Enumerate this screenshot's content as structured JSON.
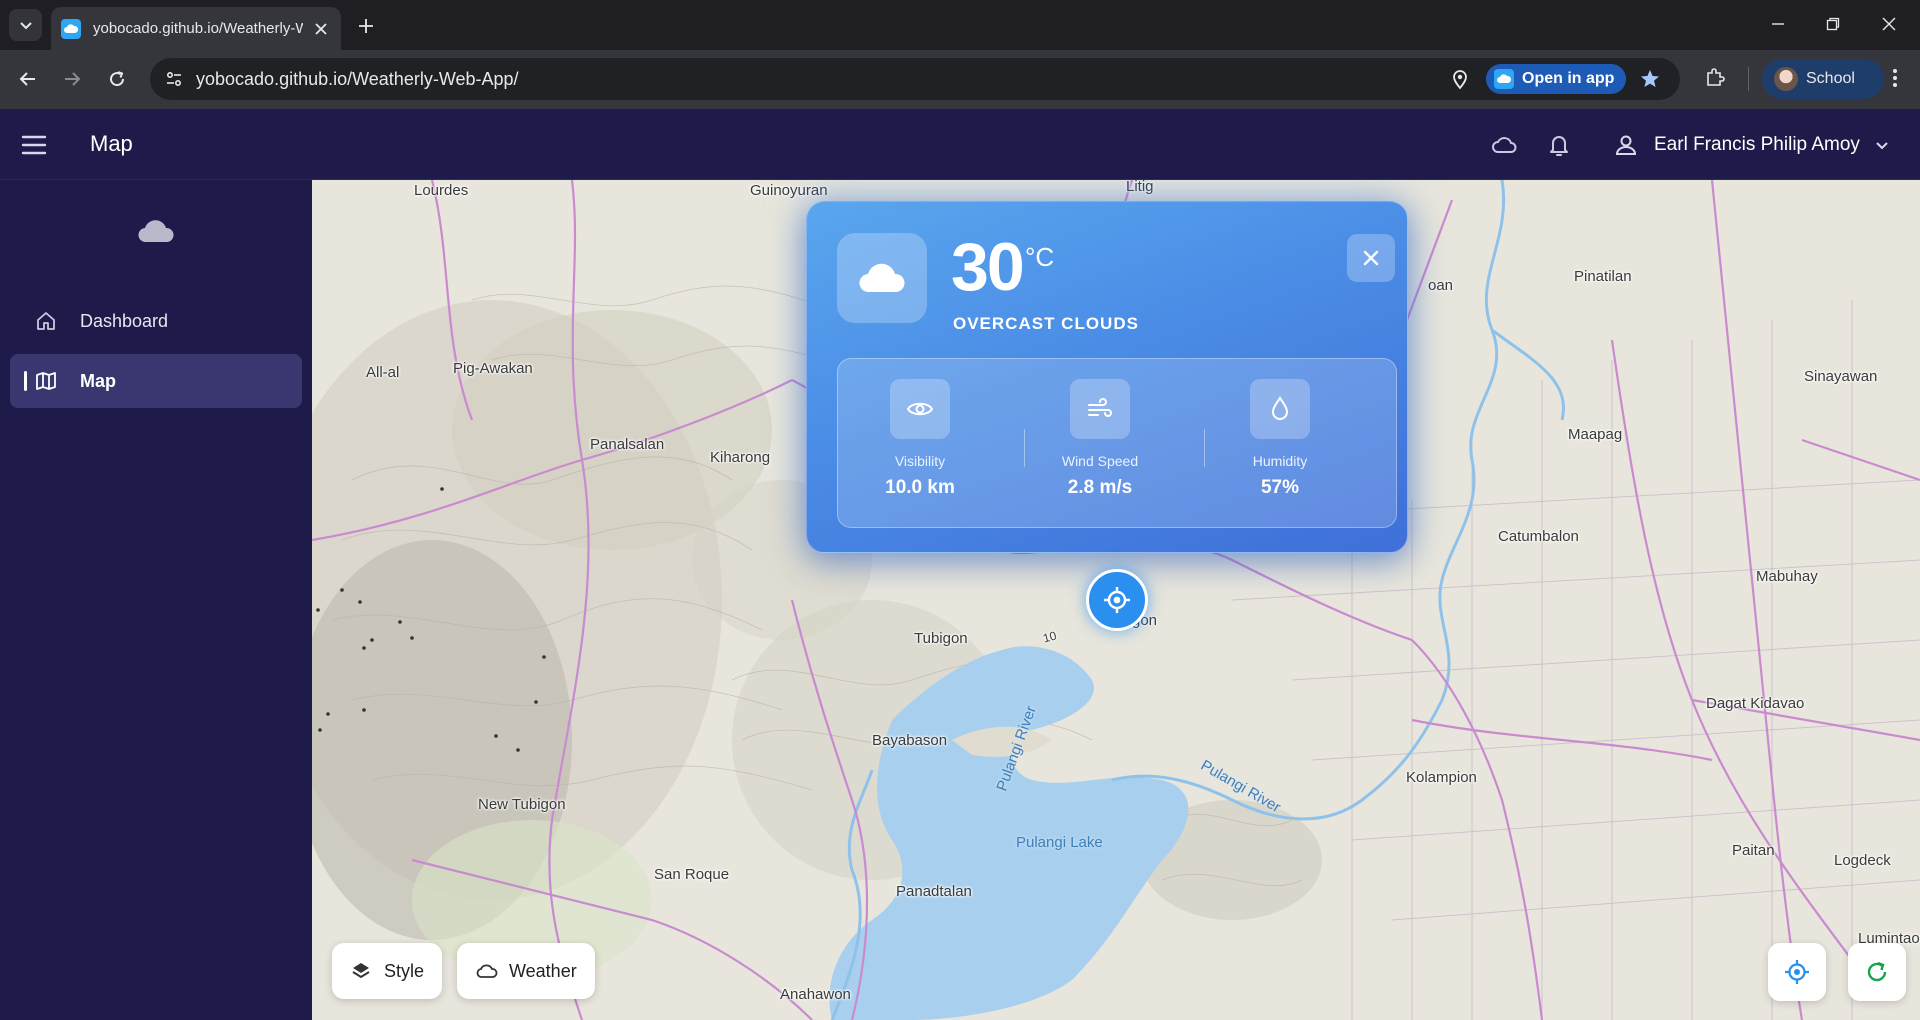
{
  "browser": {
    "tab_title": "yobocado.github.io/Weatherly-Web-App/",
    "url": "yobocado.github.io/Weatherly-Web-App/",
    "open_in_app_label": "Open in app",
    "profile_label": "School",
    "accent_color": "#a8c7fa"
  },
  "app": {
    "header_title": "Map",
    "user_name": "Earl Francis Philip Amoy",
    "brand_color": "#1e1b4b"
  },
  "sidebar": {
    "items": [
      {
        "label": "Dashboard",
        "icon": "home-icon",
        "active": false
      },
      {
        "label": "Map",
        "icon": "map-icon",
        "active": true
      }
    ]
  },
  "weather_card": {
    "temperature": "30",
    "unit": "°C",
    "condition": "OVERCAST CLOUDS",
    "stats": [
      {
        "label": "Visibility",
        "value": "10.0 km",
        "icon": "eye-icon"
      },
      {
        "label": "Wind Speed",
        "value": "2.8 m/s",
        "icon": "wind-icon"
      },
      {
        "label": "Humidity",
        "value": "57%",
        "icon": "droplet-icon"
      }
    ]
  },
  "map": {
    "places": [
      "Lourdes",
      "Guinoyuran",
      "Litig",
      "Pinatilan",
      "Pig-Awakan",
      "All-al",
      "Sinayawan",
      "Panalsalan",
      "Kiharong",
      "Maapag",
      "Catumbalon",
      "Mabuhay",
      "Tubigon",
      "gon",
      "Dagat Kidavao",
      "Bayabason",
      "Kolampion",
      "New Tubigon",
      "Paitan",
      "San Roque",
      "Panadtalan",
      "Logdeck",
      "Anahawon",
      "Lumintao",
      "oan"
    ],
    "water_labels": [
      "Pulangi Lake",
      "Pulangi River",
      "Pulangi River"
    ],
    "road_number": "10",
    "controls": {
      "style_label": "Style",
      "weather_label": "Weather"
    }
  }
}
